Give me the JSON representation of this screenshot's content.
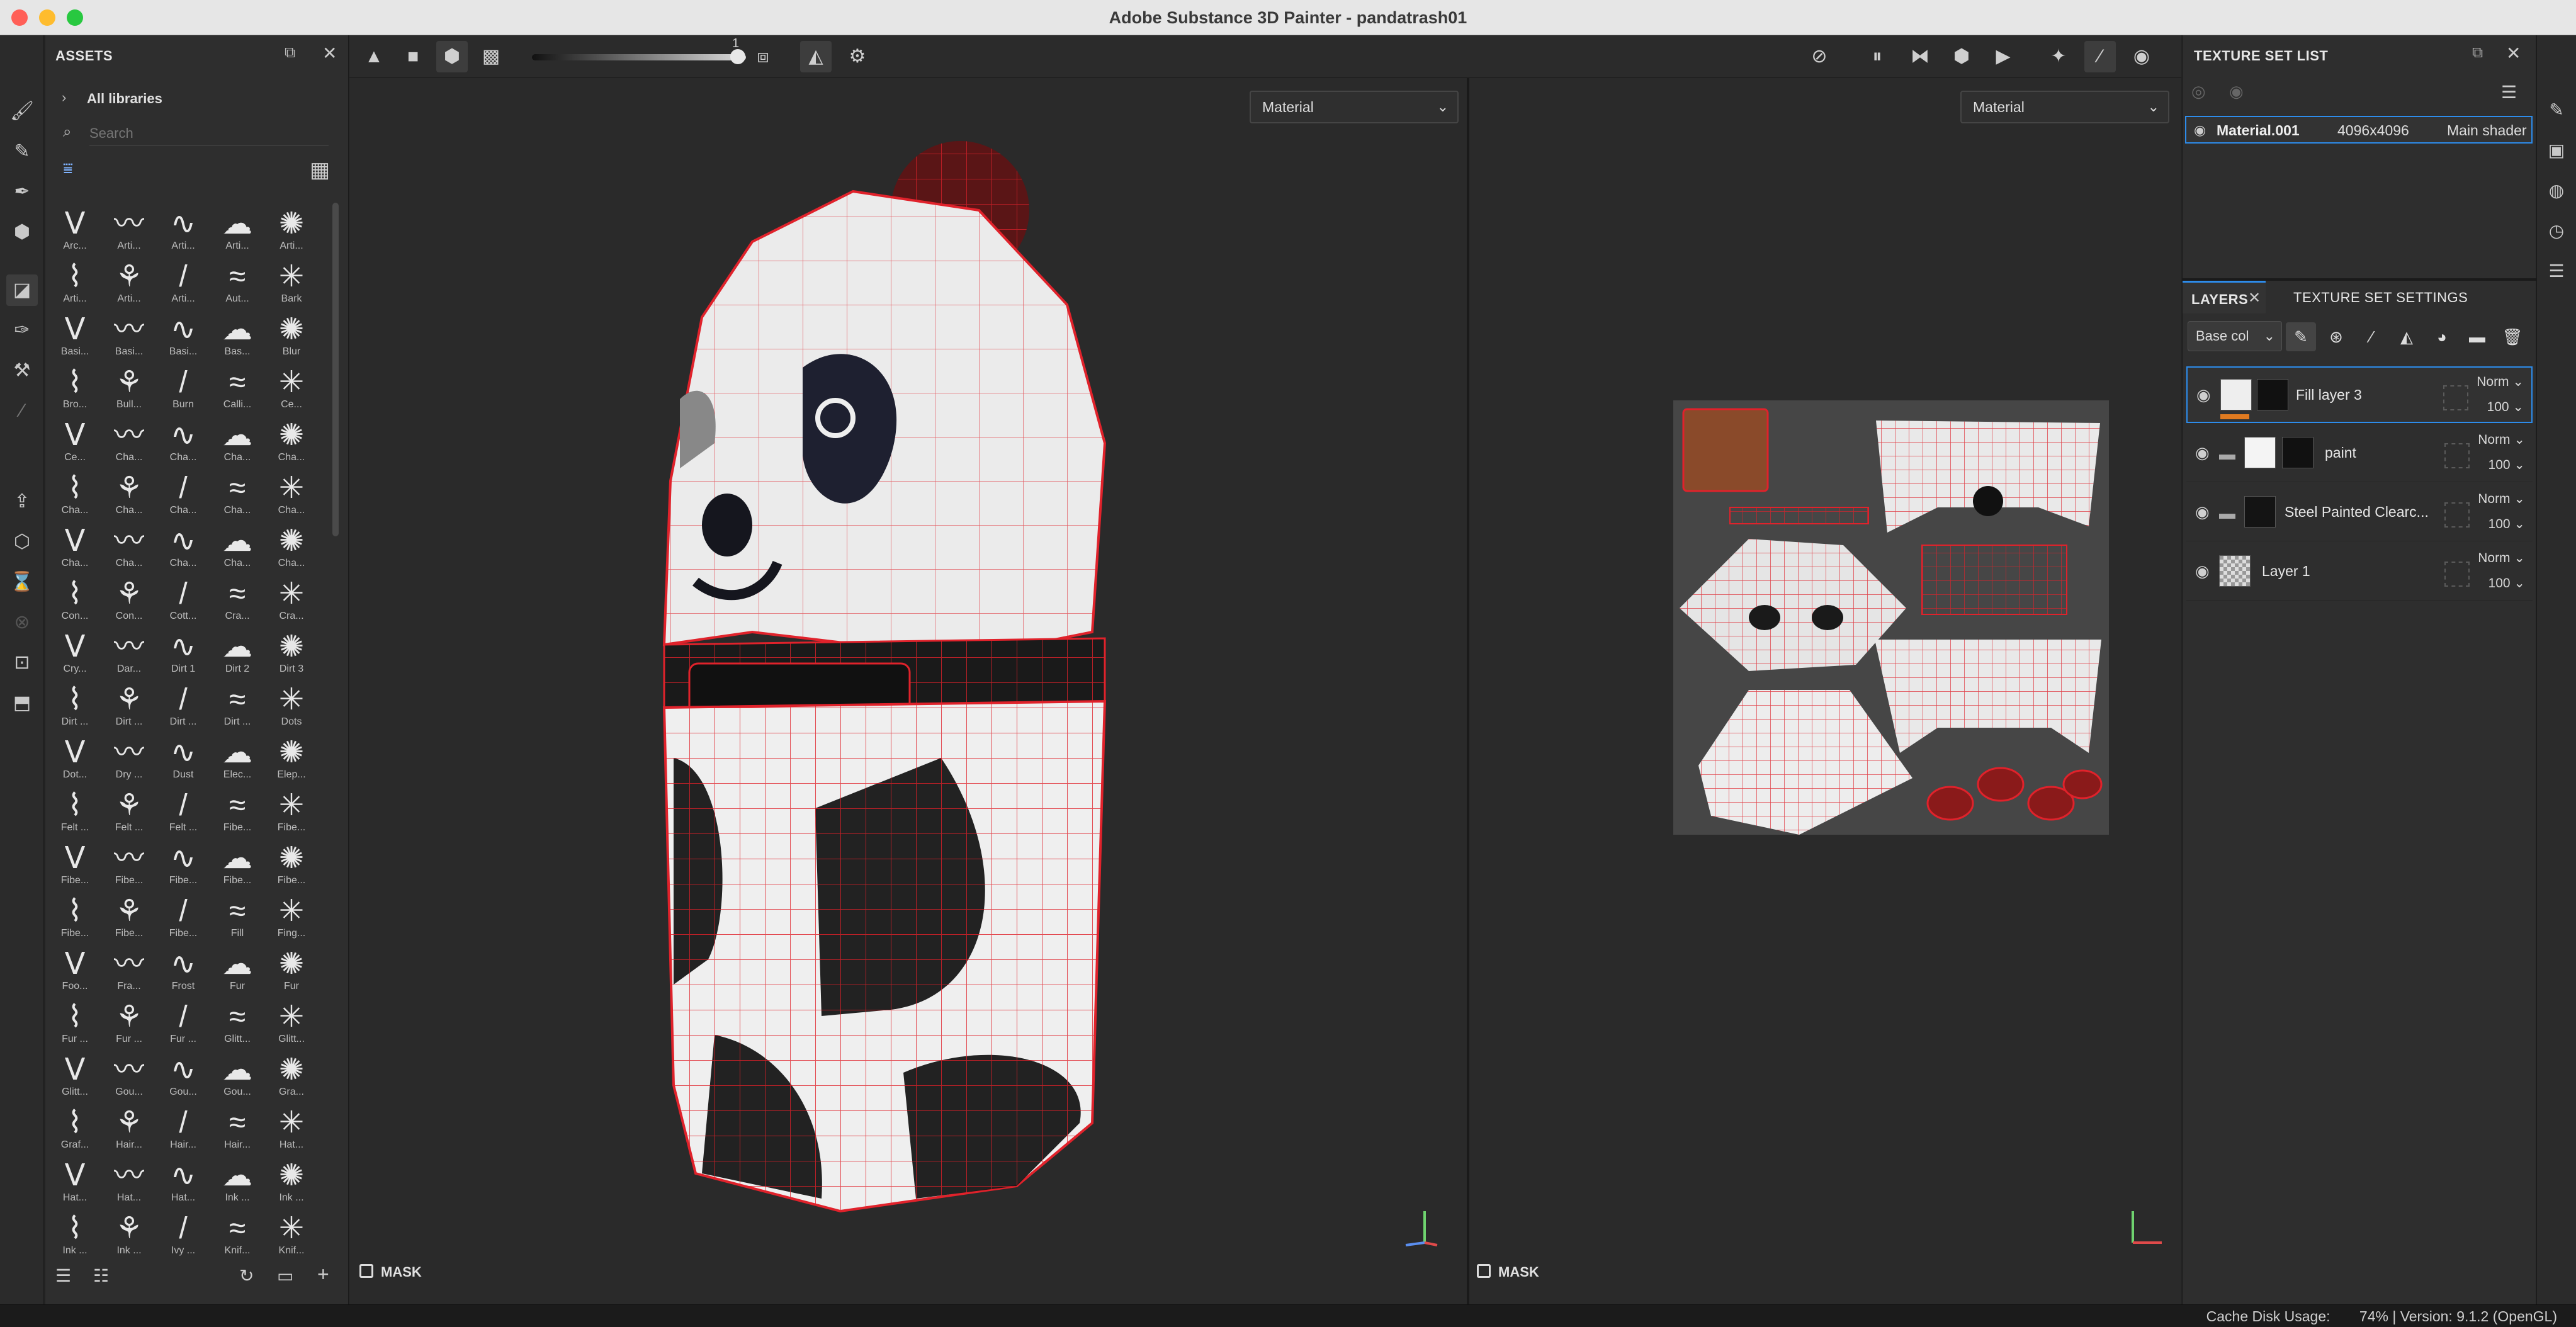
{
  "window": {
    "title": "Adobe Substance 3D Painter - pandatrash01"
  },
  "colors": {
    "accent": "#2d8ceb",
    "wire": "#e0222b",
    "selected_layer": "#2d8ceb",
    "close": "#ff5f57",
    "minimize": "#febc2e",
    "maximize": "#28c840"
  },
  "left_tools": [
    "paint-brush-icon",
    "eraser-icon",
    "projection-icon",
    "geometry-fill-icon",
    "polygon-fill-icon",
    "smudge-icon",
    "clone-stamp-icon",
    "color-picker-icon",
    "export-icon",
    "bake-icon",
    "render-icon",
    "history-icon",
    "display-icon",
    "shelf-icon"
  ],
  "assets": {
    "title": "ASSETS",
    "library": "All libraries",
    "search_placeholder": "Search",
    "brushes": [
      "Arc...",
      "Arti...",
      "Arti...",
      "Arti...",
      "Arti...",
      "Arti...",
      "Arti...",
      "Arti...",
      "Aut...",
      "Bark",
      "Basi...",
      "Basi...",
      "Basi...",
      "Bas...",
      "Blur",
      "Bro...",
      "Bull...",
      "Burn",
      "Calli...",
      "Ce...",
      "Ce...",
      "Cha...",
      "Cha...",
      "Cha...",
      "Cha...",
      "Cha...",
      "Cha...",
      "Cha...",
      "Cha...",
      "Cha...",
      "Cha...",
      "Cha...",
      "Cha...",
      "Cha...",
      "Cha...",
      "Con...",
      "Con...",
      "Cott...",
      "Cra...",
      "Cra...",
      "Cry...",
      "Dar...",
      "Dirt 1",
      "Dirt 2",
      "Dirt 3",
      "Dirt ...",
      "Dirt ...",
      "Dirt ...",
      "Dirt ...",
      "Dots",
      "Dot...",
      "Dry ...",
      "Dust",
      "Elec...",
      "Elep...",
      "Felt ...",
      "Felt ...",
      "Felt ...",
      "Fibe...",
      "Fibe...",
      "Fibe...",
      "Fibe...",
      "Fibe...",
      "Fibe...",
      "Fibe...",
      "Fibe...",
      "Fibe...",
      "Fibe...",
      "Fill",
      "Fing...",
      "Foo...",
      "Fra...",
      "Frost",
      "Fur",
      "Fur",
      "Fur ...",
      "Fur ...",
      "Fur ...",
      "Glitt...",
      "Glitt...",
      "Glitt...",
      "Gou...",
      "Gou...",
      "Gou...",
      "Gra...",
      "Graf...",
      "Hair...",
      "Hair...",
      "Hair...",
      "Hat...",
      "Hat...",
      "Hat...",
      "Hat...",
      "Ink ...",
      "Ink ...",
      "Ink ...",
      "Ink ...",
      "Ivy ...",
      "Knif...",
      "Knif..."
    ]
  },
  "toolbar": {
    "slider_value": "1"
  },
  "viewport3d": {
    "mode": "Material",
    "mask_label": "MASK"
  },
  "viewport2d": {
    "mode": "Material",
    "mask_label": "MASK"
  },
  "texture_set_list": {
    "title": "TEXTURE SET LIST",
    "items": [
      {
        "name": "Material.001",
        "resolution": "4096x4096",
        "shader": "Main shader"
      }
    ]
  },
  "layers_panel": {
    "tabs": [
      "LAYERS",
      "TEXTURE SET SETTINGS"
    ],
    "channel": "Base col",
    "layers": [
      {
        "name": "Fill layer 3",
        "blend": "Norm",
        "opacity": "100"
      },
      {
        "name": "paint",
        "blend": "Norm",
        "opacity": "100"
      },
      {
        "name": "Steel Painted Clearc...",
        "blend": "Norm",
        "opacity": "100"
      },
      {
        "name": "Layer 1",
        "blend": "Norm",
        "opacity": "100"
      }
    ]
  },
  "status": {
    "cache_label": "Cache Disk Usage:",
    "cache_value": "74% | Version: 9.1.2 (OpenGL)"
  }
}
